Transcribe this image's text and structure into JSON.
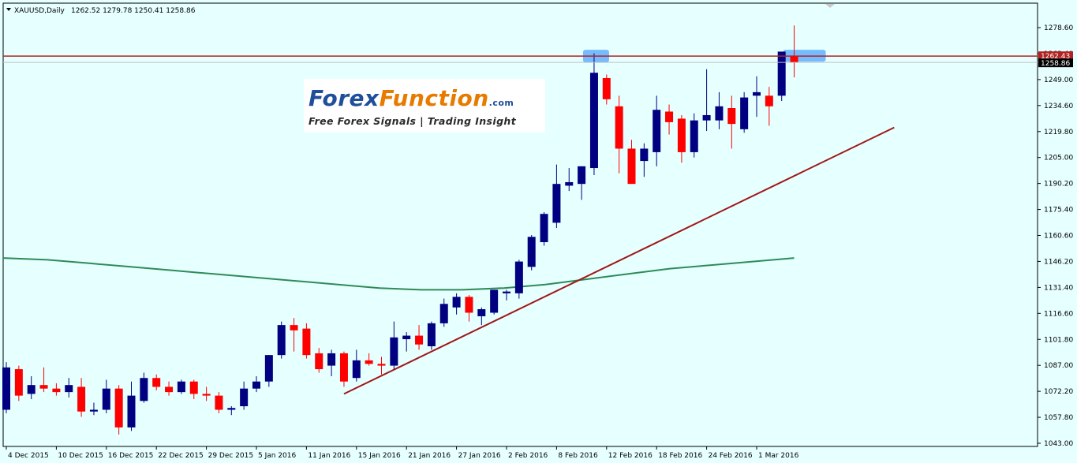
{
  "window": {
    "symbol_title": "XAUUSD,Daily",
    "ohlc_readout": "1262.52 1279.78 1250.41 1258.86"
  },
  "logo": {
    "brand_part1": "Forex",
    "brand_part2": "Function",
    "brand_suffix": ".com",
    "tagline": "Free Forex Signals | Trading Insight"
  },
  "colors": {
    "background": "#e6ffff",
    "bull": "#000080",
    "bear": "#ff0000",
    "moving_average": "#2e8b57",
    "trendline": "#a01818",
    "resistance": "#b22222",
    "highlight": "#4da6ff",
    "price_label_bg": "#b22222"
  },
  "chart_data": {
    "type": "candlestick",
    "title": "XAUUSD,Daily",
    "ylim": [
      1043.0,
      1286.0
    ],
    "y_ticks": [
      "1278.60",
      "1263.40",
      "1249.00",
      "1234.60",
      "1219.80",
      "1205.00",
      "1190.20",
      "1175.40",
      "1160.60",
      "1146.20",
      "1131.40",
      "1116.60",
      "1101.80",
      "1087.00",
      "1072.20",
      "1057.80",
      "1043.00"
    ],
    "x_ticks": [
      "4 Dec 2015",
      "10 Dec 2015",
      "16 Dec 2015",
      "22 Dec 2015",
      "29 Dec 2015",
      "5 Jan 2016",
      "11 Jan 2016",
      "15 Jan 2016",
      "21 Jan 2016",
      "27 Jan 2016",
      "2 Feb 2016",
      "8 Feb 2016",
      "12 Feb 2016",
      "18 Feb 2016",
      "24 Feb 2016",
      "1 Mar 2016"
    ],
    "candles": [
      {
        "o": 1062,
        "h": 1089,
        "l": 1060,
        "c": 1086
      },
      {
        "o": 1085,
        "h": 1087,
        "l": 1067,
        "c": 1070
      },
      {
        "o": 1071,
        "h": 1081,
        "l": 1068,
        "c": 1076
      },
      {
        "o": 1076,
        "h": 1086,
        "l": 1072,
        "c": 1074
      },
      {
        "o": 1074,
        "h": 1077,
        "l": 1070,
        "c": 1072
      },
      {
        "o": 1072,
        "h": 1080,
        "l": 1069,
        "c": 1076
      },
      {
        "o": 1075,
        "h": 1080,
        "l": 1058,
        "c": 1061
      },
      {
        "o": 1061,
        "h": 1066,
        "l": 1059,
        "c": 1062
      },
      {
        "o": 1062,
        "h": 1079,
        "l": 1060,
        "c": 1074
      },
      {
        "o": 1074,
        "h": 1076,
        "l": 1048,
        "c": 1052
      },
      {
        "o": 1052,
        "h": 1078,
        "l": 1050,
        "c": 1070
      },
      {
        "o": 1067,
        "h": 1083,
        "l": 1066,
        "c": 1080
      },
      {
        "o": 1080,
        "h": 1082,
        "l": 1073,
        "c": 1075
      },
      {
        "o": 1075,
        "h": 1078,
        "l": 1070,
        "c": 1072
      },
      {
        "o": 1072,
        "h": 1079,
        "l": 1071,
        "c": 1078
      },
      {
        "o": 1078,
        "h": 1079,
        "l": 1068,
        "c": 1071
      },
      {
        "o": 1071,
        "h": 1075,
        "l": 1067,
        "c": 1070
      },
      {
        "o": 1070,
        "h": 1072,
        "l": 1060,
        "c": 1062
      },
      {
        "o": 1062,
        "h": 1064,
        "l": 1059,
        "c": 1063
      },
      {
        "o": 1064,
        "h": 1078,
        "l": 1062,
        "c": 1074
      },
      {
        "o": 1074,
        "h": 1081,
        "l": 1072,
        "c": 1078
      },
      {
        "o": 1078,
        "h": 1093,
        "l": 1075,
        "c": 1093
      },
      {
        "o": 1093,
        "h": 1112,
        "l": 1091,
        "c": 1110
      },
      {
        "o": 1110,
        "h": 1114,
        "l": 1095,
        "c": 1107
      },
      {
        "o": 1108,
        "h": 1111,
        "l": 1091,
        "c": 1093
      },
      {
        "o": 1094,
        "h": 1097,
        "l": 1083,
        "c": 1085
      },
      {
        "o": 1087,
        "h": 1096,
        "l": 1081,
        "c": 1094
      },
      {
        "o": 1094,
        "h": 1095,
        "l": 1075,
        "c": 1078
      },
      {
        "o": 1080,
        "h": 1096,
        "l": 1078,
        "c": 1090
      },
      {
        "o": 1090,
        "h": 1094,
        "l": 1087,
        "c": 1088
      },
      {
        "o": 1088,
        "h": 1092,
        "l": 1082,
        "c": 1087
      },
      {
        "o": 1087,
        "h": 1112,
        "l": 1085,
        "c": 1103
      },
      {
        "o": 1102,
        "h": 1106,
        "l": 1095,
        "c": 1104
      },
      {
        "o": 1104,
        "h": 1110,
        "l": 1096,
        "c": 1099
      },
      {
        "o": 1098,
        "h": 1112,
        "l": 1096,
        "c": 1111
      },
      {
        "o": 1111,
        "h": 1125,
        "l": 1109,
        "c": 1122
      },
      {
        "o": 1120,
        "h": 1128,
        "l": 1116,
        "c": 1126
      },
      {
        "o": 1126,
        "h": 1127,
        "l": 1112,
        "c": 1117
      },
      {
        "o": 1115,
        "h": 1120,
        "l": 1110,
        "c": 1119
      },
      {
        "o": 1117,
        "h": 1130,
        "l": 1116,
        "c": 1130
      },
      {
        "o": 1128,
        "h": 1130,
        "l": 1124,
        "c": 1129
      },
      {
        "o": 1128,
        "h": 1147,
        "l": 1125,
        "c": 1146
      },
      {
        "o": 1143,
        "h": 1161,
        "l": 1141,
        "c": 1160
      },
      {
        "o": 1157,
        "h": 1174,
        "l": 1155,
        "c": 1173
      },
      {
        "o": 1168,
        "h": 1201,
        "l": 1165,
        "c": 1190
      },
      {
        "o": 1189,
        "h": 1199,
        "l": 1186,
        "c": 1191
      },
      {
        "o": 1190,
        "h": 1200,
        "l": 1181,
        "c": 1200
      },
      {
        "o": 1199,
        "h": 1264,
        "l": 1195,
        "c": 1253
      },
      {
        "o": 1250,
        "h": 1252,
        "l": 1235,
        "c": 1238
      },
      {
        "o": 1234,
        "h": 1240,
        "l": 1196,
        "c": 1210
      },
      {
        "o": 1210,
        "h": 1215,
        "l": 1190,
        "c": 1190
      },
      {
        "o": 1203,
        "h": 1213,
        "l": 1194,
        "c": 1210
      },
      {
        "o": 1208,
        "h": 1240,
        "l": 1200,
        "c": 1232
      },
      {
        "o": 1231,
        "h": 1235,
        "l": 1218,
        "c": 1225
      },
      {
        "o": 1227,
        "h": 1229,
        "l": 1202,
        "c": 1208
      },
      {
        "o": 1208,
        "h": 1230,
        "l": 1205,
        "c": 1226
      },
      {
        "o": 1226,
        "h": 1255,
        "l": 1220,
        "c": 1229
      },
      {
        "o": 1226,
        "h": 1242,
        "l": 1221,
        "c": 1234
      },
      {
        "o": 1233,
        "h": 1240,
        "l": 1210,
        "c": 1224
      },
      {
        "o": 1221,
        "h": 1242,
        "l": 1219,
        "c": 1239
      },
      {
        "o": 1240,
        "h": 1251,
        "l": 1228,
        "c": 1242
      },
      {
        "o": 1240,
        "h": 1245,
        "l": 1223,
        "c": 1234
      },
      {
        "o": 1240,
        "h": 1263,
        "l": 1237,
        "c": 1265
      },
      {
        "o": 1262.5,
        "h": 1279.8,
        "l": 1250.4,
        "c": 1258.9
      }
    ],
    "moving_average": [
      1148,
      1147,
      1145,
      1143,
      1141,
      1139,
      1137,
      1135,
      1133,
      1131,
      1130,
      1130,
      1131,
      1133,
      1136,
      1139,
      1142,
      1144,
      1146,
      1148
    ],
    "trendline": {
      "from_index": 27,
      "from_price": 1071,
      "to_index": 71,
      "to_price": 1222
    },
    "resistance_level": 1262.43,
    "current_price": 1258.86,
    "labels": {
      "resistance_label": "1262.43",
      "current_label": "1258.86"
    }
  }
}
